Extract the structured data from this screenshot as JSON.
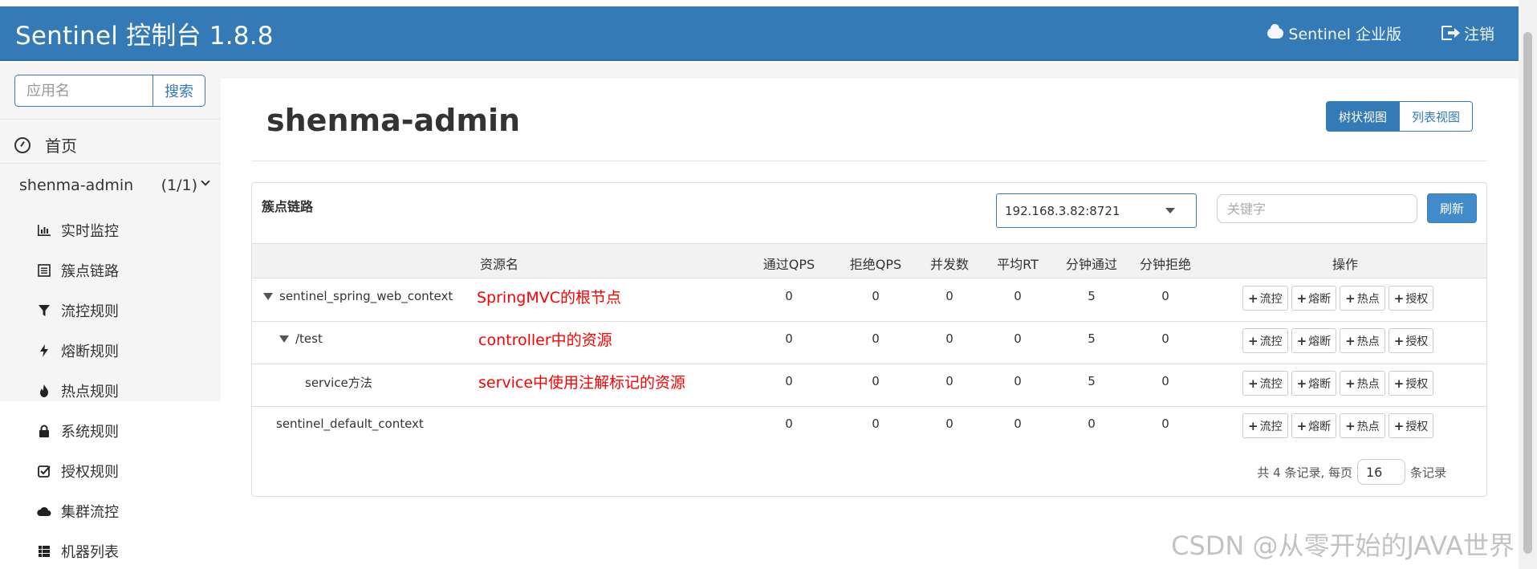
{
  "header": {
    "brand": "Sentinel 控制台 1.8.8",
    "enterprise_label": "Sentinel 企业版",
    "logout_label": "注销"
  },
  "sidebar": {
    "search_placeholder": "应用名",
    "search_button": "搜索",
    "home_label": "首页",
    "app": {
      "name": "shenma-admin",
      "count": "(1/1)"
    },
    "items": [
      {
        "label": "实时监控",
        "icon": "bar-chart-icon"
      },
      {
        "label": "簇点链路",
        "icon": "list-icon"
      },
      {
        "label": "流控规则",
        "icon": "filter-icon"
      },
      {
        "label": "熔断规则",
        "icon": "flash-icon"
      },
      {
        "label": "热点规则",
        "icon": "fire-icon"
      },
      {
        "label": "系统规则",
        "icon": "lock-icon"
      },
      {
        "label": "授权规则",
        "icon": "check-square-icon"
      },
      {
        "label": "集群流控",
        "icon": "cloud-icon"
      },
      {
        "label": "机器列表",
        "icon": "th-list-icon"
      }
    ]
  },
  "main": {
    "title": "shenma-admin",
    "view_tree": "树状视图",
    "view_list": "列表视图",
    "panel_title": "簇点链路",
    "machine": "192.168.3.82:8721",
    "keyword_placeholder": "关键字",
    "refresh": "刷新",
    "columns": [
      "资源名",
      "通过QPS",
      "拒绝QPS",
      "并发数",
      "平均RT",
      "分钟通过",
      "分钟拒绝",
      "操作"
    ],
    "rows": [
      {
        "resource": "sentinel_spring_web_context",
        "pass_qps": "0",
        "block_qps": "0",
        "threads": "0",
        "avg_rt": "0",
        "minute_pass": "5",
        "minute_block": "0",
        "note": "SpringMVC的根节点"
      },
      {
        "resource": "/test",
        "pass_qps": "0",
        "block_qps": "0",
        "threads": "0",
        "avg_rt": "0",
        "minute_pass": "5",
        "minute_block": "0",
        "note": "controller中的资源"
      },
      {
        "resource": "service方法",
        "pass_qps": "0",
        "block_qps": "0",
        "threads": "0",
        "avg_rt": "0",
        "minute_pass": "5",
        "minute_block": "0",
        "note": "service中使用注解标记的资源"
      },
      {
        "resource": "sentinel_default_context",
        "pass_qps": "0",
        "block_qps": "0",
        "threads": "0",
        "avg_rt": "0",
        "minute_pass": "0",
        "minute_block": "0",
        "note": ""
      }
    ],
    "actions": [
      "流控",
      "熔断",
      "热点",
      "授权"
    ],
    "pager": {
      "total_text": "共 4 条记录, 每页",
      "page_size": "16",
      "suffix": "条记录"
    }
  },
  "watermark": "CSDN @从零开始的JAVA世界"
}
